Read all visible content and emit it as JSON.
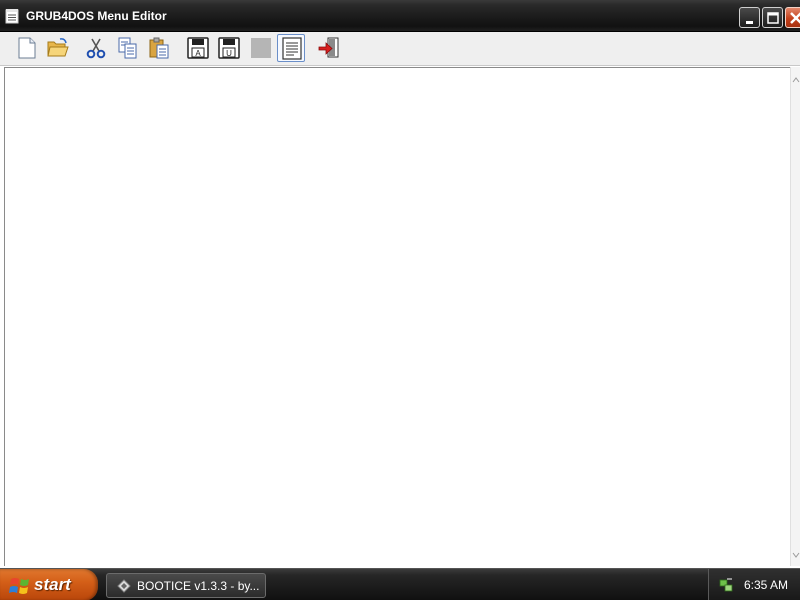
{
  "window": {
    "title": "GRUB4DOS Menu Editor",
    "controls": {
      "minimize": "minimize-icon",
      "maximize": "maximize-icon",
      "close": "close-icon"
    }
  },
  "toolbar": {
    "buttons": [
      {
        "name": "new-file-button",
        "icon": "new-file-icon"
      },
      {
        "name": "open-folder-button",
        "icon": "open-folder-icon"
      },
      {
        "name": "cut-button",
        "icon": "scissors-icon"
      },
      {
        "name": "copy-button",
        "icon": "copy-icon"
      },
      {
        "name": "paste-button",
        "icon": "paste-icon"
      },
      {
        "name": "save-ansi-button",
        "icon": "floppy-disk-icon",
        "badge": "A"
      },
      {
        "name": "save-unicode-button",
        "icon": "floppy-disk-icon",
        "badge": "U"
      },
      {
        "name": "disabled-button",
        "icon": "blank-icon"
      },
      {
        "name": "word-wrap-button",
        "icon": "document-icon",
        "state": "pressed"
      },
      {
        "name": "exit-button",
        "icon": "exit-door-icon"
      }
    ]
  },
  "editor": {
    "content": ""
  },
  "taskbar": {
    "start_label": "start",
    "tasks": [
      {
        "label": "BOOTICE v1.3.3 - by...",
        "icon": "bootice-icon"
      }
    ],
    "tray": {
      "icons": [
        "network-icon"
      ],
      "clock": "6:35 AM"
    }
  },
  "colors": {
    "titlebar": "#1d1d1d",
    "toolbar": "#efefef",
    "close_button": "#c3411c",
    "start_button": "#d45f18",
    "taskbar": "#1b1b1b",
    "pressed_border": "#6a8fc9"
  }
}
